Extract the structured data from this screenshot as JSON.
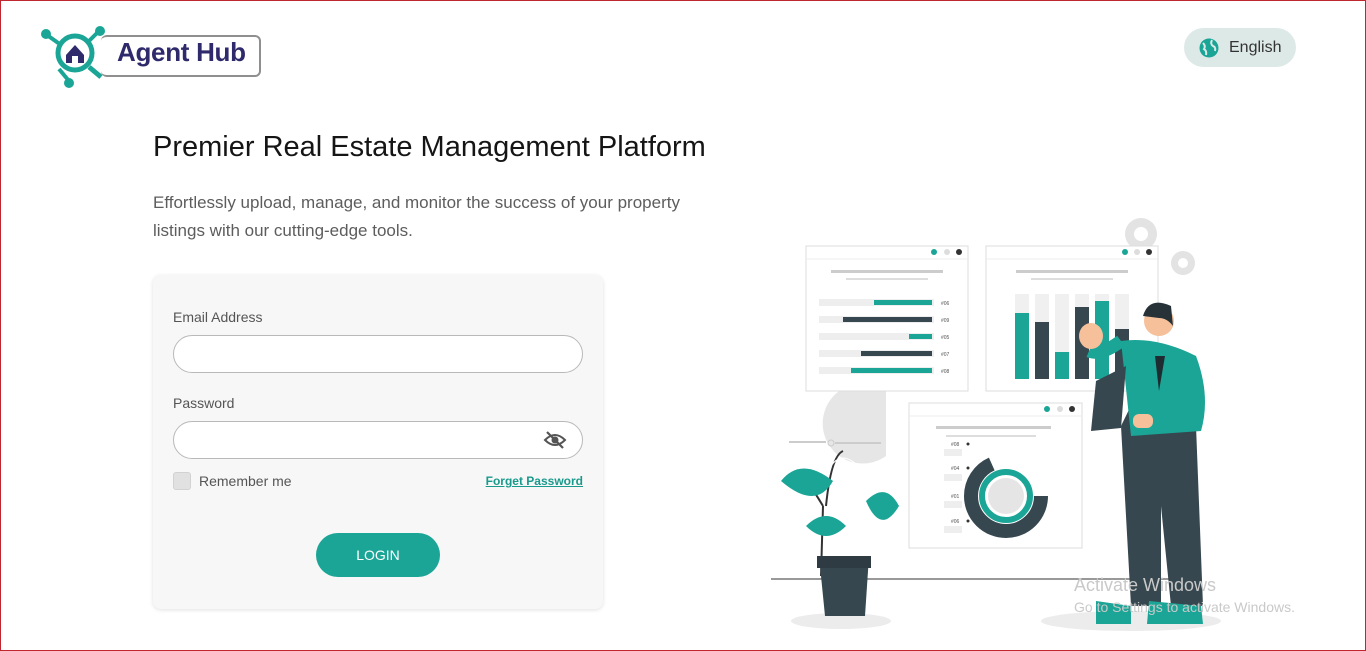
{
  "brand": {
    "name": "Agent Hub"
  },
  "language": {
    "label": "English",
    "icon": "globe-icon"
  },
  "hero": {
    "title": "Premier Real Estate Management Platform",
    "subtitle": "Effortlessly upload, manage, and monitor the success of your property listings with our cutting-edge tools."
  },
  "login_form": {
    "email_label": "Email Address",
    "email_value": "",
    "password_label": "Password",
    "password_value": "",
    "remember_label": "Remember me",
    "remember_checked": false,
    "forgot_label": "Forget Password",
    "submit_label": "LOGIN",
    "eye_icon": "eye-slash-icon"
  },
  "colors": {
    "accent": "#1aa596",
    "brand_navy": "#2f2a6b",
    "dark": "#37474f"
  },
  "illustration": {
    "bar_labels": [
      "#06",
      "#09",
      "#05",
      "#07",
      "#08"
    ],
    "donut_labels": [
      "#08",
      "#04",
      "#01",
      "#06"
    ]
  },
  "watermark": {
    "line1": "Activate Windows",
    "line2": "Go to Settings to activate Windows."
  }
}
